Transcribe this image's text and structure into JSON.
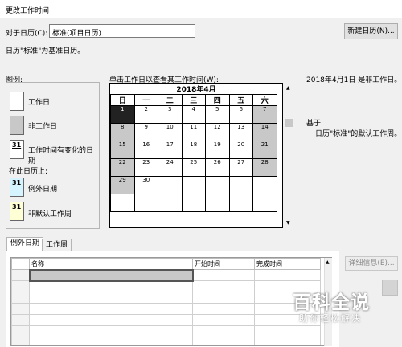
{
  "window": {
    "title": "更改工作时间"
  },
  "for_calendar": {
    "label": "对于日历(C):",
    "value": "标准(项目日历)"
  },
  "new_calendar_button": "新建日历(N)...",
  "base_calendar_text": "日历\"标准\"为基准日历。",
  "legend": {
    "title": "图例:",
    "items": [
      {
        "label": "工作日"
      },
      {
        "label": "非工作日"
      },
      {
        "label": "工作时间有变化的日期",
        "num": "31"
      }
    ],
    "section_title": "在此日历上:",
    "items2": [
      {
        "label": "例外日期",
        "num": "31"
      },
      {
        "label": "非默认工作周",
        "num": "31"
      }
    ]
  },
  "calendar_label": "单击工作日以查看其工作时间(W):",
  "calendar": {
    "month_title": "2018年4月",
    "weekdays": [
      "日",
      "一",
      "二",
      "三",
      "四",
      "五",
      "六"
    ],
    "weeks": [
      [
        "1",
        "2",
        "3",
        "4",
        "5",
        "6",
        "7"
      ],
      [
        "8",
        "9",
        "10",
        "11",
        "12",
        "13",
        "14"
      ],
      [
        "15",
        "16",
        "17",
        "18",
        "19",
        "20",
        "21"
      ],
      [
        "22",
        "23",
        "24",
        "25",
        "26",
        "27",
        "28"
      ],
      [
        "29",
        "30",
        "",
        "",
        "",
        "",
        ""
      ],
      [
        "",
        "",
        "",
        "",
        "",
        "",
        ""
      ]
    ]
  },
  "date_info": "2018年4月1日 是非工作日。",
  "based_on": {
    "label": "基于:",
    "text": "日历\"标准\"的默认工作周。"
  },
  "tabs": [
    "例外日期",
    "工作周"
  ],
  "exceptions_table": {
    "columns": [
      "名称",
      "开始时间",
      "完成时间"
    ],
    "row_count": 8
  },
  "details_button": "详细信息(E)...",
  "watermark": {
    "title": "百科全说",
    "subtitle": "助你轻松解决"
  },
  "colors": {
    "nonwork": "#c8c8c8",
    "selected": "#222222",
    "exception_swatch": "#d6f4ff",
    "nondefault_swatch": "#ffffd6"
  }
}
